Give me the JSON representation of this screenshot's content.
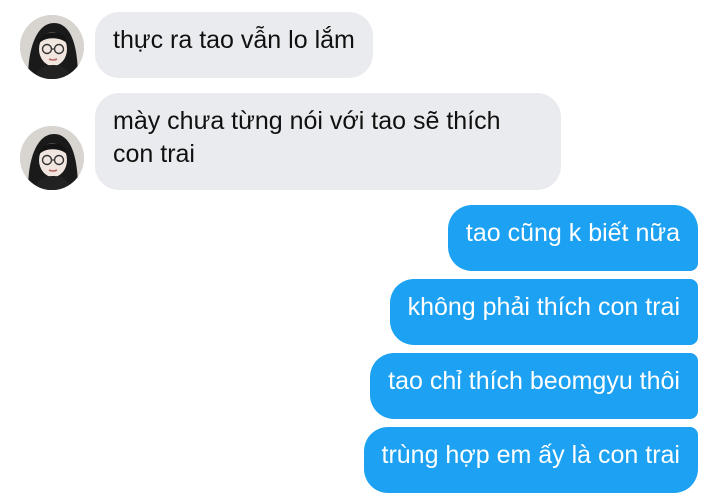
{
  "conversation": {
    "incoming": [
      {
        "text": "thực ra tao vẫn lo lắm"
      },
      {
        "text": "mày chưa từng nói với tao sẽ thích con trai"
      }
    ],
    "outgoing": [
      {
        "text": "tao cũng k biết nữa"
      },
      {
        "text": "không phải thích con trai"
      },
      {
        "text": "tao chỉ thích beomgyu thôi"
      },
      {
        "text": "trùng hợp em ấy là con trai"
      }
    ]
  },
  "colors": {
    "incoming_bubble": "#eaebee",
    "outgoing_bubble": "#1da1f2",
    "incoming_text": "#101010",
    "outgoing_text": "#ffffff"
  },
  "icons": {
    "avatar": "contact-avatar"
  }
}
